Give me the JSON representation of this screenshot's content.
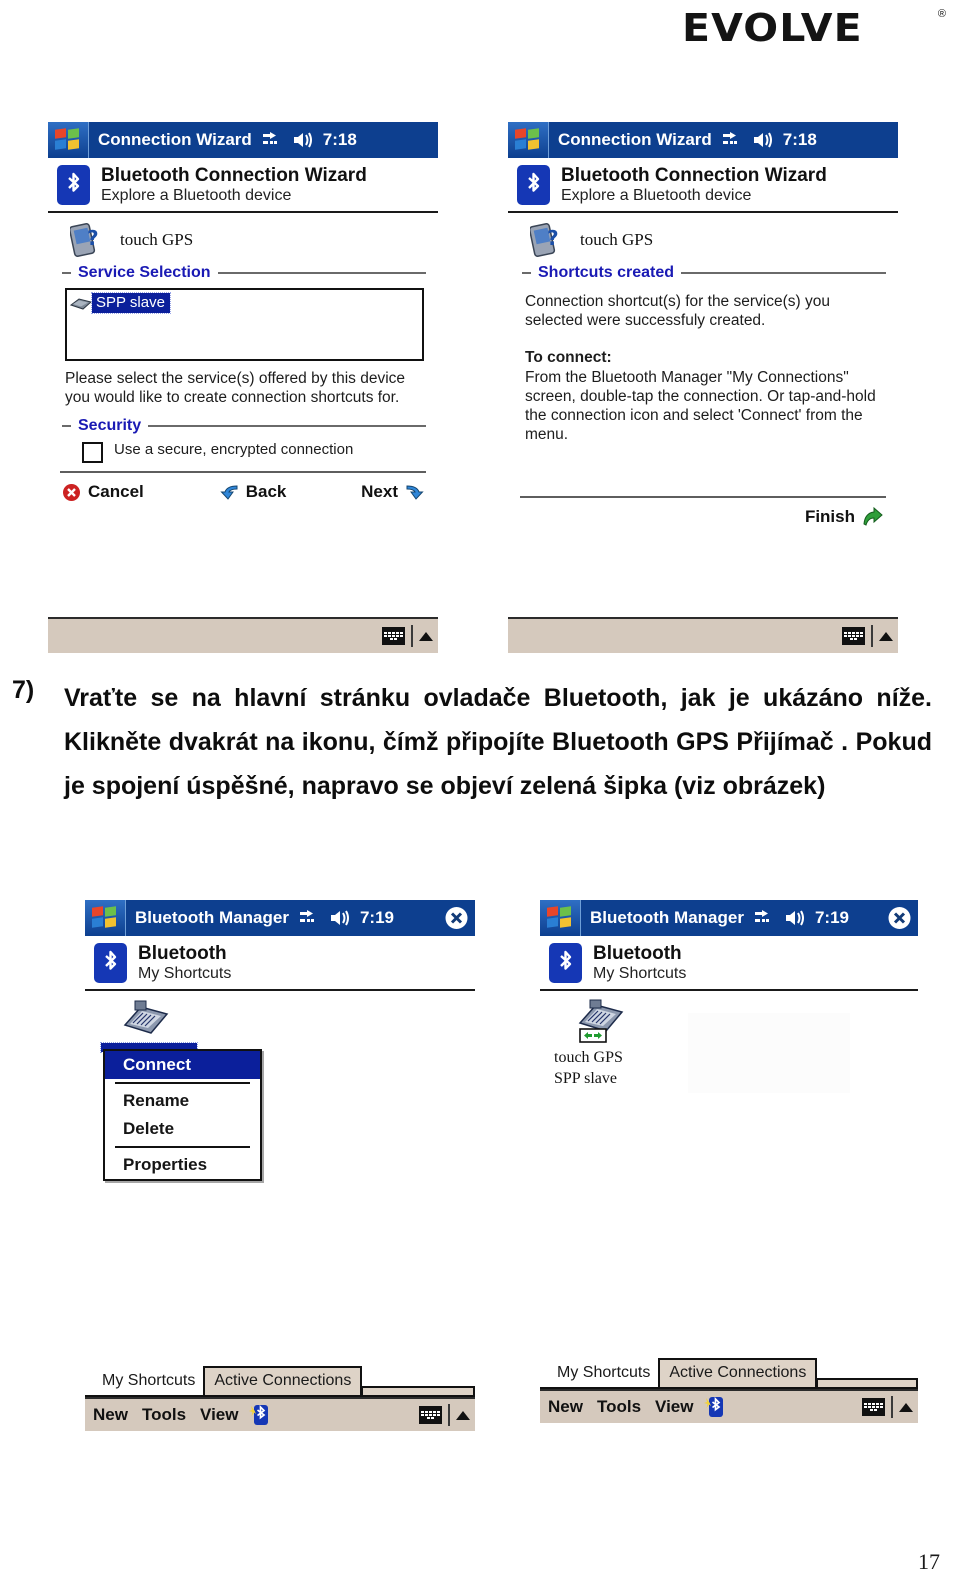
{
  "brand": {
    "logo_text": "EVOLVE",
    "registered_mark": "®"
  },
  "page": {
    "number": "17"
  },
  "instruction": {
    "number": "7)",
    "text": "Vraťte se na hlavní stránku ovladače Bluetooth, jak je ukázáno níže. Klikněte dvakrát na ikonu, čímž připojíte Bluetooth GPS Přijímač . Pokud je spojení úspěšné, napravo se objeví zelená šipka (viz obrázek)"
  },
  "screens": {
    "wizard_service": {
      "titlebar": {
        "title": "Connection Wizard",
        "time": "7:18",
        "start_icon": "windows-flag-icon",
        "network_icon": "network-connect-icon",
        "volume_icon": "speaker-icon"
      },
      "header": {
        "title": "Bluetooth Connection Wizard",
        "subtitle": "Explore a Bluetooth device",
        "icon": "bluetooth-icon"
      },
      "device": {
        "name": "touch GPS",
        "icon": "bluetooth-device-query-icon"
      },
      "group_service": {
        "label": "Service Selection"
      },
      "service_item": {
        "label": "SPP slave",
        "icon": "serial-port-icon",
        "selected": true
      },
      "help": "Please select the service(s) offered by this device you would like to create connection shortcuts for.",
      "group_security": {
        "label": "Security"
      },
      "security_checkbox": {
        "label": "Use a secure, encrypted connection",
        "checked": false
      },
      "buttons": {
        "cancel": "Cancel",
        "back": "Back",
        "next": "Next"
      },
      "softkeys": {
        "keyboard_icon": "keyboard-icon",
        "expand_icon": "chevron-up-icon"
      }
    },
    "wizard_finish": {
      "titlebar": {
        "title": "Connection Wizard",
        "time": "7:18",
        "start_icon": "windows-flag-icon",
        "network_icon": "network-connect-icon",
        "volume_icon": "speaker-icon"
      },
      "header": {
        "title": "Bluetooth Connection Wizard",
        "subtitle": "Explore a Bluetooth device",
        "icon": "bluetooth-icon"
      },
      "device": {
        "name": "touch GPS",
        "icon": "bluetooth-device-query-icon"
      },
      "group_shortcuts": {
        "label": "Shortcuts created"
      },
      "body_1": "Connection shortcut(s)  for the service(s) you selected were successfuly created.",
      "body_2_title": "To connect:",
      "body_2": "From the Bluetooth Manager \"My Connections\" screen, double-tap the connection. Or tap-and-hold the connection icon and select 'Connect' from the menu.",
      "buttons": {
        "finish": "Finish"
      },
      "softkeys": {
        "keyboard_icon": "keyboard-icon",
        "expand_icon": "chevron-up-icon"
      }
    },
    "manager_menu": {
      "titlebar": {
        "title": "Bluetooth Manager",
        "time": "7:19",
        "start_icon": "windows-flag-icon",
        "network_icon": "network-connect-icon",
        "volume_icon": "speaker-icon",
        "close_icon": "close-icon"
      },
      "header": {
        "title": "Bluetooth",
        "subtitle": "My Shortcuts",
        "icon": "bluetooth-icon"
      },
      "shortcut": {
        "icon": "serial-connection-shortcut-icon"
      },
      "context_menu": {
        "items": [
          "Connect",
          "Rename",
          "Delete",
          "Properties"
        ],
        "selected": "Connect"
      },
      "tabs": {
        "active": "My Shortcuts",
        "inactive": "Active Connections"
      },
      "menubar": {
        "items": [
          "New",
          "Tools",
          "View"
        ],
        "bluetooth_icon": "bluetooth-new-icon",
        "keyboard_icon": "keyboard-icon",
        "expand_icon": "chevron-up-icon"
      }
    },
    "manager_connected": {
      "titlebar": {
        "title": "Bluetooth Manager",
        "time": "7:19",
        "start_icon": "windows-flag-icon",
        "network_icon": "network-connect-icon",
        "volume_icon": "speaker-icon",
        "close_icon": "close-icon"
      },
      "header": {
        "title": "Bluetooth",
        "subtitle": "My Shortcuts",
        "icon": "bluetooth-icon"
      },
      "shortcut": {
        "icon": "serial-connection-shortcut-connected-icon",
        "label_line1": "touch GPS",
        "label_line2": "SPP slave",
        "green_arrow": true
      },
      "tabs": {
        "active": "My Shortcuts",
        "inactive": "Active Connections"
      },
      "menubar": {
        "items": [
          "New",
          "Tools",
          "View"
        ],
        "bluetooth_icon": "bluetooth-new-icon",
        "keyboard_icon": "keyboard-icon",
        "expand_icon": "chevron-up-icon"
      }
    }
  },
  "colors": {
    "titlebar_blue": "#0d3f8f",
    "group_label_blue": "#1a1ab4",
    "selection_blue": "#0b1f9b",
    "softkey_bar": "#d5c9bd",
    "green_arrow": "#1f9b2f",
    "cancel_red": "#cc2222"
  }
}
